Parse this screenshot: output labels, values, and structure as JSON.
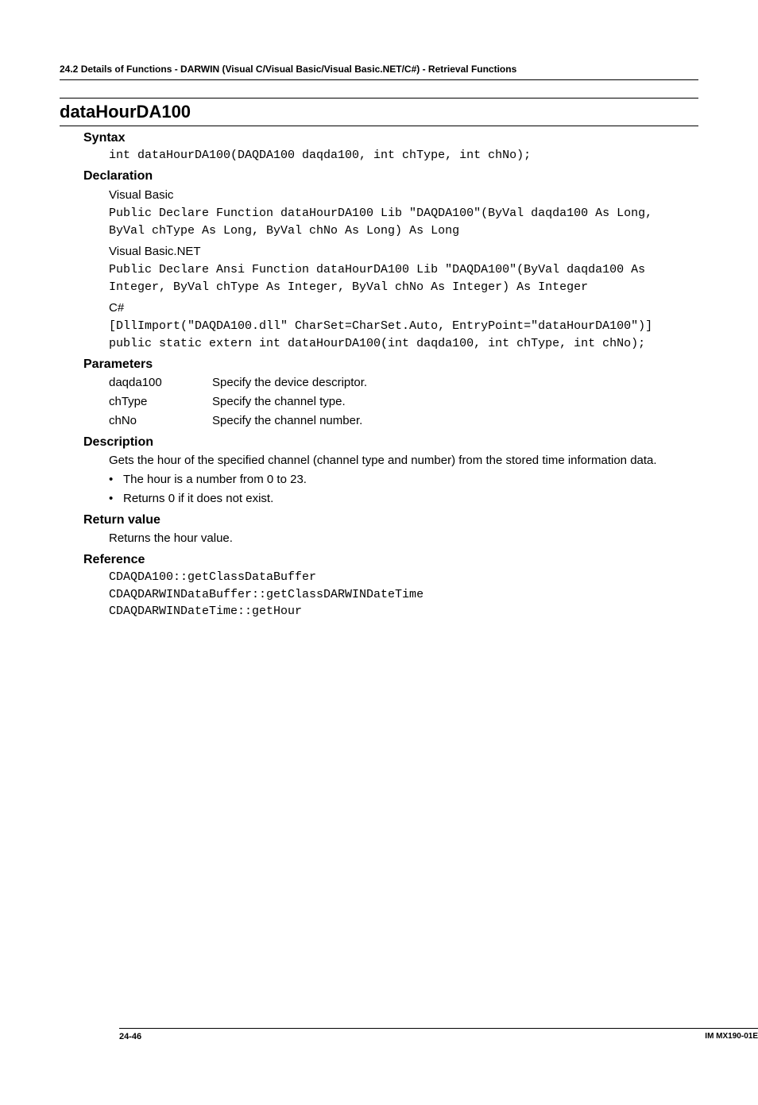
{
  "header": "24.2  Details of Functions - DARWIN (Visual C/Visual Basic/Visual Basic.NET/C#) - Retrieval Functions",
  "functionName": "dataHourDA100",
  "headings": {
    "syntax": "Syntax",
    "declaration": "Declaration",
    "parameters": "Parameters",
    "description": "Description",
    "returnValue": "Return value",
    "reference": "Reference"
  },
  "syntax": {
    "code": "int dataHourDA100(DAQDA100 daqda100, int chType, int chNo);"
  },
  "declaration": {
    "vb_label": "Visual Basic",
    "vb_code": "Public Declare Function dataHourDA100 Lib \"DAQDA100\"(ByVal daqda100 As Long, ByVal chType As Long, ByVal chNo As Long) As Long",
    "vbnet_label": "Visual Basic.NET",
    "vbnet_code": "Public Declare Ansi Function dataHourDA100 Lib \"DAQDA100\"(ByVal daqda100 As Integer, ByVal chType As Integer, ByVal chNo As Integer) As Integer",
    "cs_label": "C#",
    "cs_code": "[DllImport(\"DAQDA100.dll\" CharSet=CharSet.Auto, EntryPoint=\"dataHourDA100\")]\npublic static extern int dataHourDA100(int daqda100, int chType, int chNo);"
  },
  "parameters": [
    {
      "name": "daqda100",
      "desc": "Specify the device descriptor."
    },
    {
      "name": "chType",
      "desc": "Specify the channel type."
    },
    {
      "name": "chNo",
      "desc": "Specify the channel number."
    }
  ],
  "description": {
    "intro": "Gets the hour of the specified channel (channel type and number) from the stored time information data.",
    "bullets": [
      "The hour is a number from 0 to 23.",
      "Returns 0 if it does not exist."
    ]
  },
  "returnValue": "Returns the hour value.",
  "reference": "CDAQDA100::getClassDataBuffer\nCDAQDARWINDataBuffer::getClassDARWINDateTime\nCDAQDARWINDateTime::getHour",
  "footer": {
    "left": "24-46",
    "right": "IM MX190-01E"
  }
}
